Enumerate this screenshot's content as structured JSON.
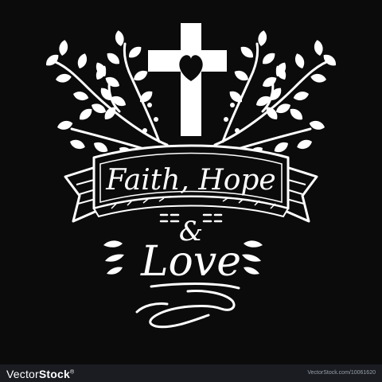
{
  "artwork": {
    "title_line1": "Faith, Hope",
    "ampersand": "&",
    "title_line2": "Love"
  },
  "footer": {
    "brand_light": "Vector",
    "brand_bold": "Stock",
    "brand_mark": "®",
    "right_text": "VectorStock.com/10061620"
  },
  "colors": {
    "background": "#0b0b0b",
    "ink": "#ffffff",
    "footer_bar": "#1a1c22"
  },
  "icons": [
    "cross-icon",
    "heart-icon",
    "olive-branch-icon",
    "ribbon-banner",
    "flourish-icon"
  ]
}
